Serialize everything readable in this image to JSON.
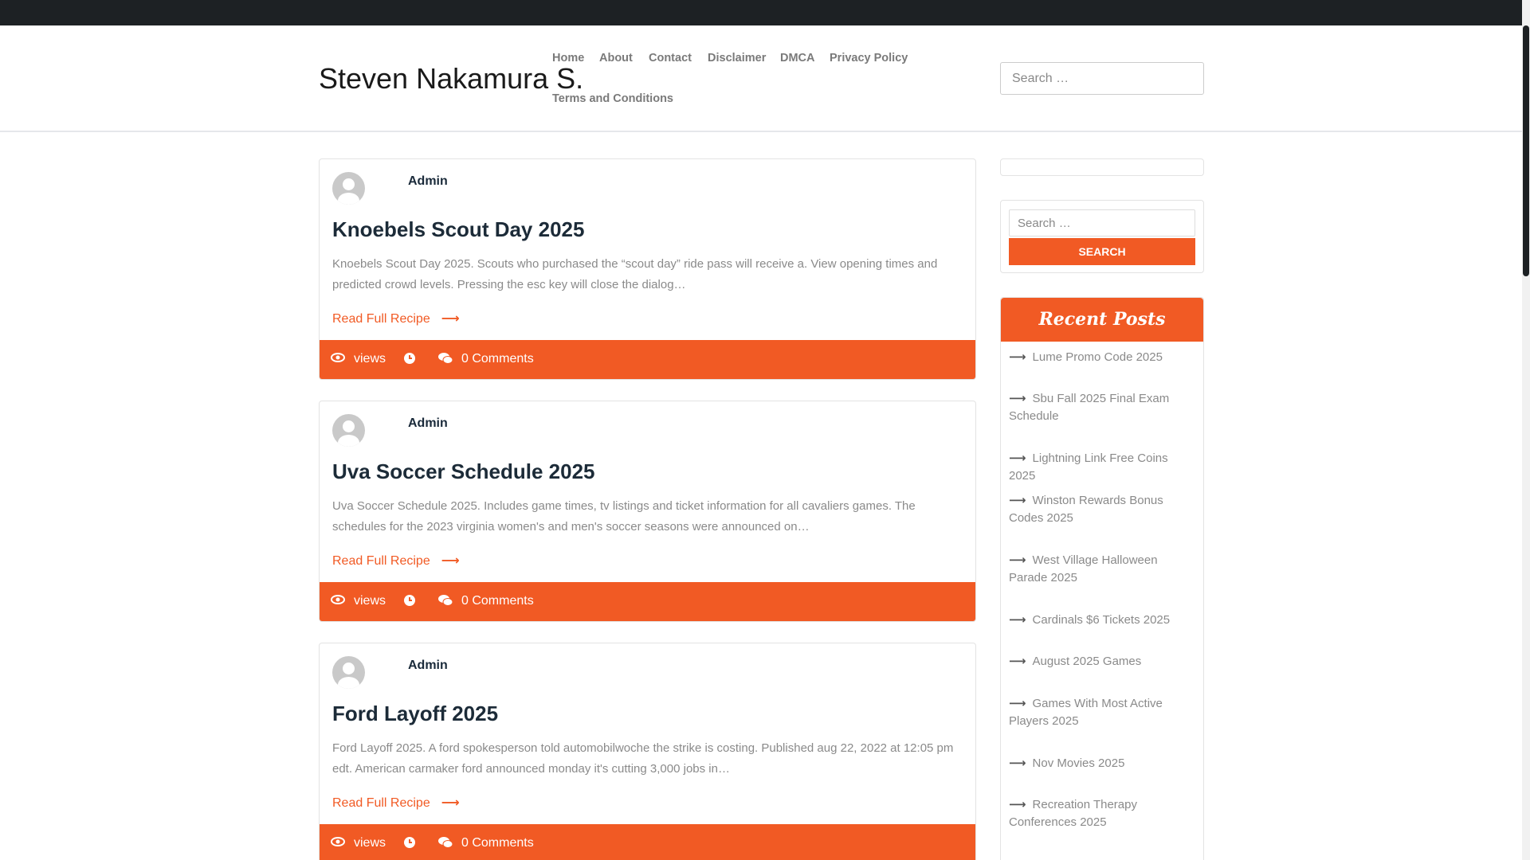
{
  "site": {
    "title": "Steven Nakamura S.",
    "search_placeholder": "Search …"
  },
  "nav": {
    "items": [
      {
        "label": "Home"
      },
      {
        "label": "About"
      },
      {
        "label": "Contact"
      },
      {
        "label": "Disclaimer"
      },
      {
        "label": "DMCA"
      },
      {
        "label": "Privacy Policy"
      },
      {
        "label": "Terms and Conditions"
      }
    ]
  },
  "posts": [
    {
      "author": "Admin",
      "title": "Knoebels Scout Day 2025",
      "excerpt": "Knoebels Scout Day 2025. Scouts who purchased the “scout day” ride pass will receive a. View opening times and predicted crowd levels. Pressing the esc key will close the dialog…",
      "read_more": "Read Full Recipe",
      "views_label": "views",
      "comments_label": "0 Comments"
    },
    {
      "author": "Admin",
      "title": "Uva Soccer Schedule 2025",
      "excerpt": "Uva Soccer Schedule 2025. Includes game times, tv listings and ticket information for all cavaliers games. The schedules for the 2023 virginia women's and men's soccer seasons were announced on…",
      "read_more": "Read Full Recipe",
      "views_label": "views",
      "comments_label": "0 Comments"
    },
    {
      "author": "Admin",
      "title": "Ford Layoff 2025",
      "excerpt": "Ford Layoff 2025. A ford spokesperson told automobilwoche the strike is costing. Published aug 22, 2022 at 12:05 pm edt. American carmaker ford announced monday it's cutting 3,000 jobs in…",
      "read_more": "Read Full Recipe",
      "views_label": "views",
      "comments_label": "0 Comments"
    }
  ],
  "sidebar": {
    "search_placeholder": "Search …",
    "search_button": "Search",
    "recent_title": "Recent Posts",
    "recent_posts": [
      "Lume Promo Code 2025",
      "Sbu Fall 2025 Final Exam Schedule",
      "Lightning Link Free Coins 2025",
      "Winston Rewards Bonus Codes 2025",
      "West Village Halloween Parade 2025",
      "Cardinals $6 Tickets 2025",
      "August 2025 Games",
      "Games With Most Active Players 2025",
      "Nov Movies 2025",
      "Recreation Therapy Conferences 2025"
    ]
  },
  "icons": {
    "views": "eye-icon",
    "time": "clock-icon",
    "comments": "comments-icon",
    "read_more": "arrow-right-icon"
  },
  "colors": {
    "accent": "#f15a24",
    "topbar": "#1d2124"
  }
}
